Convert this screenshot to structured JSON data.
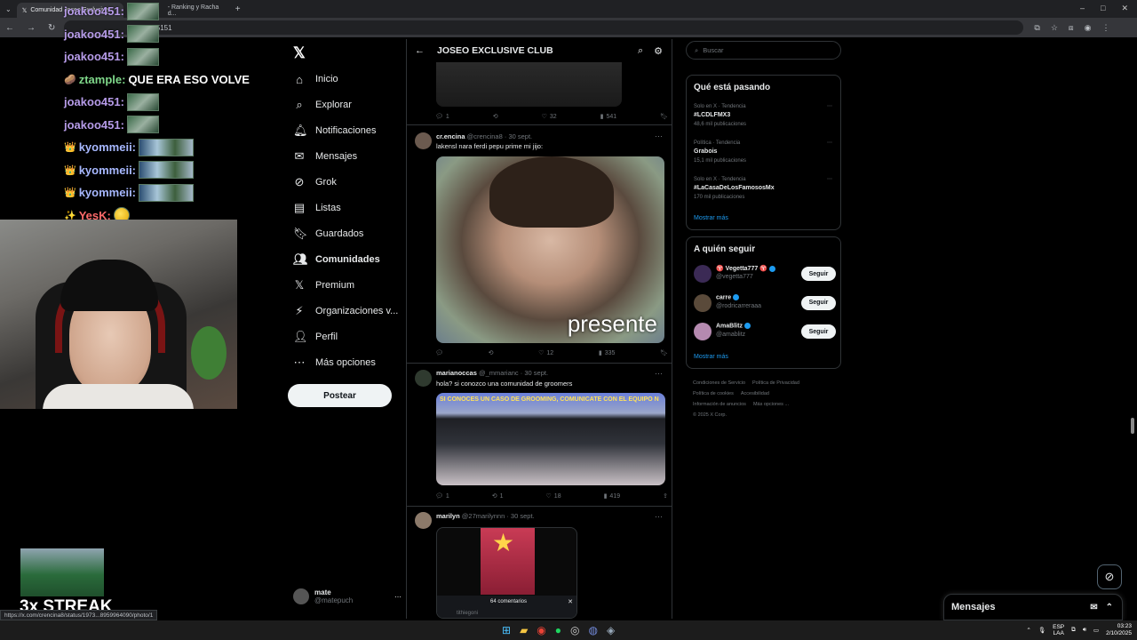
{
  "browser": {
    "tabs": [
      {
        "label": "Comunidad Joseo Exclusive"
      },
      {
        "label": "- Ranking y Racha d..."
      }
    ],
    "url": "...5407805151",
    "status_url": "https://x.com/crencina8/status/1973...8959964090/photo/1"
  },
  "chat": [
    {
      "user": "joakoo451:",
      "color": "#b69be8",
      "badge": "",
      "emote": "square",
      "text": ""
    },
    {
      "user": "joakoo451:",
      "color": "#b69be8",
      "badge": "",
      "emote": "square",
      "text": ""
    },
    {
      "user": "joakoo451:",
      "color": "#b69be8",
      "badge": "",
      "emote": "square",
      "text": ""
    },
    {
      "user": "ztample:",
      "color": "#7fd88a",
      "badge": "🥔",
      "emote": "",
      "text": "QUE ERA ESO VOLVE"
    },
    {
      "user": "joakoo451:",
      "color": "#b69be8",
      "badge": "",
      "emote": "square",
      "text": ""
    },
    {
      "user": "joakoo451:",
      "color": "#b69be8",
      "badge": "",
      "emote": "square",
      "text": ""
    },
    {
      "user": "kyommeii:",
      "color": "#a7b8ff",
      "badge": "👑",
      "emote": "wide",
      "text": ""
    },
    {
      "user": "kyommeii:",
      "color": "#a7b8ff",
      "badge": "👑",
      "emote": "wide",
      "text": ""
    },
    {
      "user": "kyommeii:",
      "color": "#a7b8ff",
      "badge": "👑",
      "emote": "wide",
      "text": ""
    },
    {
      "user": "YesK:",
      "color": "#ff6a6a",
      "badge": "✨",
      "emote": "round",
      "text": ""
    }
  ],
  "streak": {
    "label": "3x STREAK"
  },
  "nav": {
    "items": [
      {
        "label": "Inicio",
        "icon": "⌂",
        "bold": false
      },
      {
        "label": "Explorar",
        "icon": "⌕",
        "bold": false
      },
      {
        "label": "Notificaciones",
        "icon": "🔔︎",
        "bold": false
      },
      {
        "label": "Mensajes",
        "icon": "✉",
        "bold": false
      },
      {
        "label": "Grok",
        "icon": "⊘",
        "bold": false
      },
      {
        "label": "Listas",
        "icon": "▤",
        "bold": false
      },
      {
        "label": "Guardados",
        "icon": "🔖︎",
        "bold": false
      },
      {
        "label": "Comunidades",
        "icon": "👥︎",
        "bold": true
      },
      {
        "label": "Premium",
        "icon": "𝕏",
        "bold": false
      },
      {
        "label": "Organizaciones v...",
        "icon": "⚡︎",
        "bold": false
      },
      {
        "label": "Perfil",
        "icon": "👤︎",
        "bold": false
      },
      {
        "label": "Más opciones",
        "icon": "⋯",
        "bold": false
      }
    ],
    "post_button": "Postear",
    "account": {
      "name": "mate",
      "handle": "@matepuch"
    }
  },
  "feed": {
    "title": "JOSEO EXCLUSIVE CLUB",
    "top_actions": {
      "reply": "1",
      "repost": "",
      "like": "32",
      "views": "541"
    },
    "tweets": [
      {
        "name": "cr.encina",
        "handle": "@crencina8",
        "date": "30 sept.",
        "text": "lakensl nara ferdi pepu prime mi jijo:",
        "media_caption": "presente",
        "reply": "",
        "repost": "",
        "like": "12",
        "views": "335"
      },
      {
        "name": "marianoccas",
        "handle": "@_mmarianc",
        "date": "30 sept.",
        "text": "hola? si conozco una comunidad de groomers",
        "media_caption": "SI CONOCES UN CASO DE GROOMING, COMUNÍCATE CON EL EQUIPO N",
        "reply": "1",
        "repost": "1",
        "like": "18",
        "views": "419"
      },
      {
        "name": "marilyn",
        "handle": "@27marilynnn",
        "date": "30 sept.",
        "text": "",
        "comments_label": "64 comentarios",
        "comment_user": "tithiegoni"
      }
    ]
  },
  "right": {
    "search_placeholder": "Buscar",
    "trending_title": "Qué está pasando",
    "trends": [
      {
        "context": "Solo en X · Tendencia",
        "name": "#LCDLFMX3",
        "count": "48,6 mil publicaciones"
      },
      {
        "context": "Política · Tendencia",
        "name": "Grabois",
        "count": "15,1 mil publicaciones"
      },
      {
        "context": "Solo en X · Tendencia",
        "name": "#LaCasaDeLosFamososMx",
        "count": "170 mil publicaciones"
      }
    ],
    "show_more": "Mostrar más",
    "follow_title": "A quién seguir",
    "follow": [
      {
        "name": "♈ Vegetta777 ♈",
        "handle": "@vegetta777",
        "button": "Seguir"
      },
      {
        "name": "carre",
        "handle": "@rodricarreraaa",
        "button": "Seguir"
      },
      {
        "name": "AmaBlitz",
        "handle": "@amablitz",
        "button": "Seguir"
      }
    ],
    "show_more_2": "Mostrar más",
    "footer": [
      "Condiciones de Servicio",
      "Política de Privacidad",
      "Política de cookies",
      "Accesibilidad",
      "Información de anuncios",
      "Más opciones ...",
      "© 2025 X Corp."
    ]
  },
  "messages": {
    "label": "Mensajes"
  },
  "taskbar": {
    "lang": "ESP",
    "lang2": "LAA",
    "time": "03:23",
    "date": "2/10/2025"
  },
  "colors": {
    "accent": "#1d9bf0",
    "bg": "#000000",
    "border": "#2f3336"
  }
}
